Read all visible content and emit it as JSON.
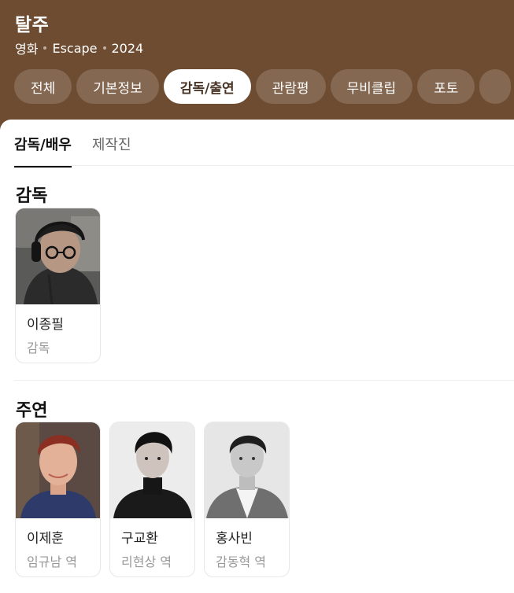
{
  "header": {
    "title": "탈주",
    "meta": [
      "영화",
      "Escape",
      "2024"
    ]
  },
  "tabs": [
    {
      "label": "전체",
      "active": false
    },
    {
      "label": "기본정보",
      "active": false
    },
    {
      "label": "감독/출연",
      "active": true
    },
    {
      "label": "관람평",
      "active": false
    },
    {
      "label": "무비클립",
      "active": false
    },
    {
      "label": "포토",
      "active": false
    }
  ],
  "subtabs": [
    {
      "label": "감독/배우",
      "active": true
    },
    {
      "label": "제작진",
      "active": false
    }
  ],
  "sections": {
    "director": {
      "title": "감독",
      "people": [
        {
          "name": "이종필",
          "role": "감독",
          "photo": "photo-director"
        }
      ]
    },
    "cast": {
      "title": "주연",
      "people": [
        {
          "name": "이제훈",
          "role": "임규남 역",
          "photo": "photo-actor-1"
        },
        {
          "name": "구교환",
          "role": "리현상 역",
          "photo": "photo-actor-2"
        },
        {
          "name": "홍사빈",
          "role": "감동혁 역",
          "photo": "photo-actor-3"
        }
      ]
    }
  },
  "colors": {
    "header_bg": "#6e4c31",
    "active_tab_text": "#4a3527",
    "role_text": "#999999"
  }
}
